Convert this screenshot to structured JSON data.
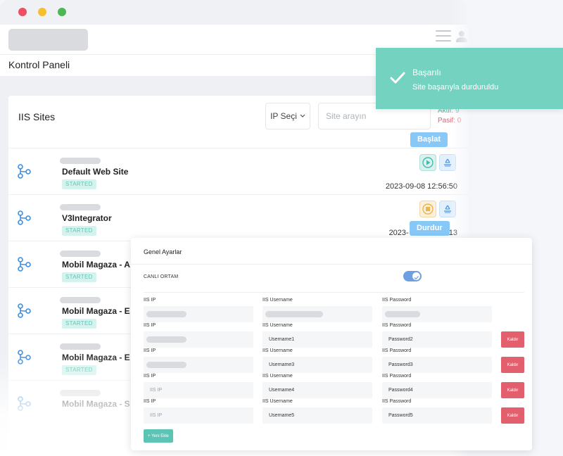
{
  "header": {
    "page_title": "Kontrol Paneli"
  },
  "card": {
    "title": "IIS Sites",
    "ip_select_label": "IP Seçi",
    "search_placeholder": "Site arayın",
    "active_label": "Aktif: 9",
    "passive_label": "Pasif: 0"
  },
  "sites": [
    {
      "name": "Default Web Site",
      "status": "STARTED",
      "timestamp": "2023-09-08 12:56:50"
    },
    {
      "name": "V3Integrator",
      "status": "STARTED",
      "timestamp": "2023-",
      "timestamp_tail": ":13"
    },
    {
      "name": "Mobil Magaza - A",
      "status": "STARTED"
    },
    {
      "name": "Mobil Magaza - E",
      "status": "STARTED"
    },
    {
      "name": "Mobil Magaza - E",
      "status": "STARTED"
    },
    {
      "name": "Mobil Magaza - S"
    }
  ],
  "tooltips": {
    "start": "Başlat",
    "stop": "Durdur"
  },
  "toast": {
    "title": "Başarılı",
    "message": "Site başarıyla durduruldu"
  },
  "settings": {
    "title": "Genel Ayarlar",
    "env_label": "CANLI ORTAM",
    "env_enabled": true,
    "labels": {
      "ip": "IIS IP",
      "username": "IIS Username",
      "password": "IIS Password"
    },
    "remove_label": "Kaldır",
    "add_label": "+ Yeni Ekle",
    "rows": [
      {
        "ip": "",
        "username": "",
        "password": ""
      },
      {
        "ip": "",
        "username": "Username1",
        "password": "Password2"
      },
      {
        "ip": "",
        "username": "Username3",
        "password": "Password3"
      },
      {
        "ip": "IIS IP",
        "username": "Username4",
        "password": "Password4"
      },
      {
        "ip": "IIS IP",
        "username": "Username5",
        "password": "Password5"
      }
    ]
  },
  "colors": {
    "accent_teal": "#73d2c0",
    "active_green": "#47c1a4",
    "passive_red": "#e4606d",
    "tooltip_blue": "#88c8f7",
    "remove_red": "#e2606e"
  }
}
